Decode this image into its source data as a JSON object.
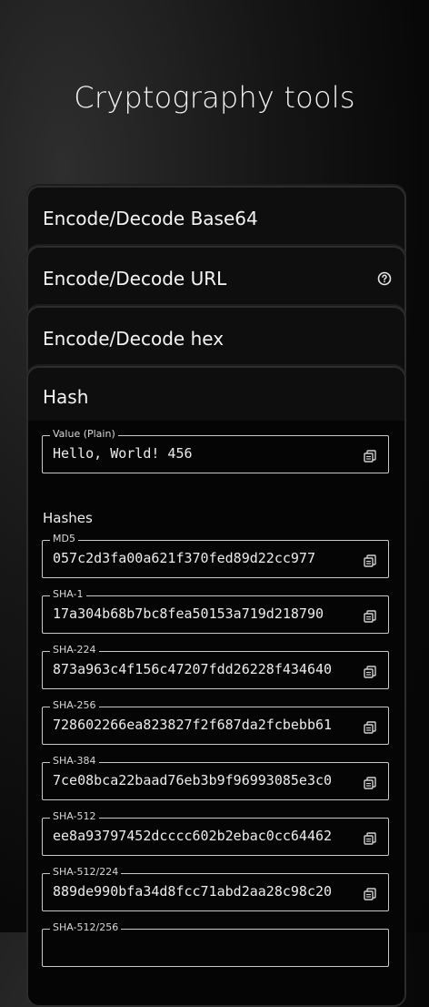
{
  "page": {
    "title": "Cryptography tools"
  },
  "tools": [
    {
      "label": "Encode/Decode Base64"
    },
    {
      "label": "Encode/Decode URL"
    },
    {
      "label": "Encode/Decode hex"
    },
    {
      "label": "Hash"
    }
  ],
  "hash": {
    "input": {
      "label": "Value (Plain)",
      "value": "Hello, World! 456"
    },
    "section_label": "Hashes",
    "items": [
      {
        "label": "MD5",
        "value": "057c2d3fa00a621f370fed89d22cc977"
      },
      {
        "label": "SHA-1",
        "value": "17a304b68b7bc8fea50153a719d218790"
      },
      {
        "label": "SHA-224",
        "value": "873a963c4f156c47207fdd26228f434640"
      },
      {
        "label": "SHA-256",
        "value": "728602266ea823827f2f687da2fcbebb61"
      },
      {
        "label": "SHA-384",
        "value": "7ce08bca22baad76eb3b9f96993085e3c0"
      },
      {
        "label": "SHA-512",
        "value": "ee8a93797452dcccc602b2ebac0cc64462"
      },
      {
        "label": "SHA-512/224",
        "value": "889de990bfa34d8fcc71abd2aa28c98c20"
      },
      {
        "label": "SHA-512/256",
        "value": ""
      }
    ]
  },
  "icons": {
    "help": "help-circle-icon",
    "copy": "copy-icon"
  },
  "colors": {
    "background": "#050505",
    "card": "#0e0e0e",
    "field_border": "#c9c9c9",
    "text": "#f0f0f0"
  }
}
